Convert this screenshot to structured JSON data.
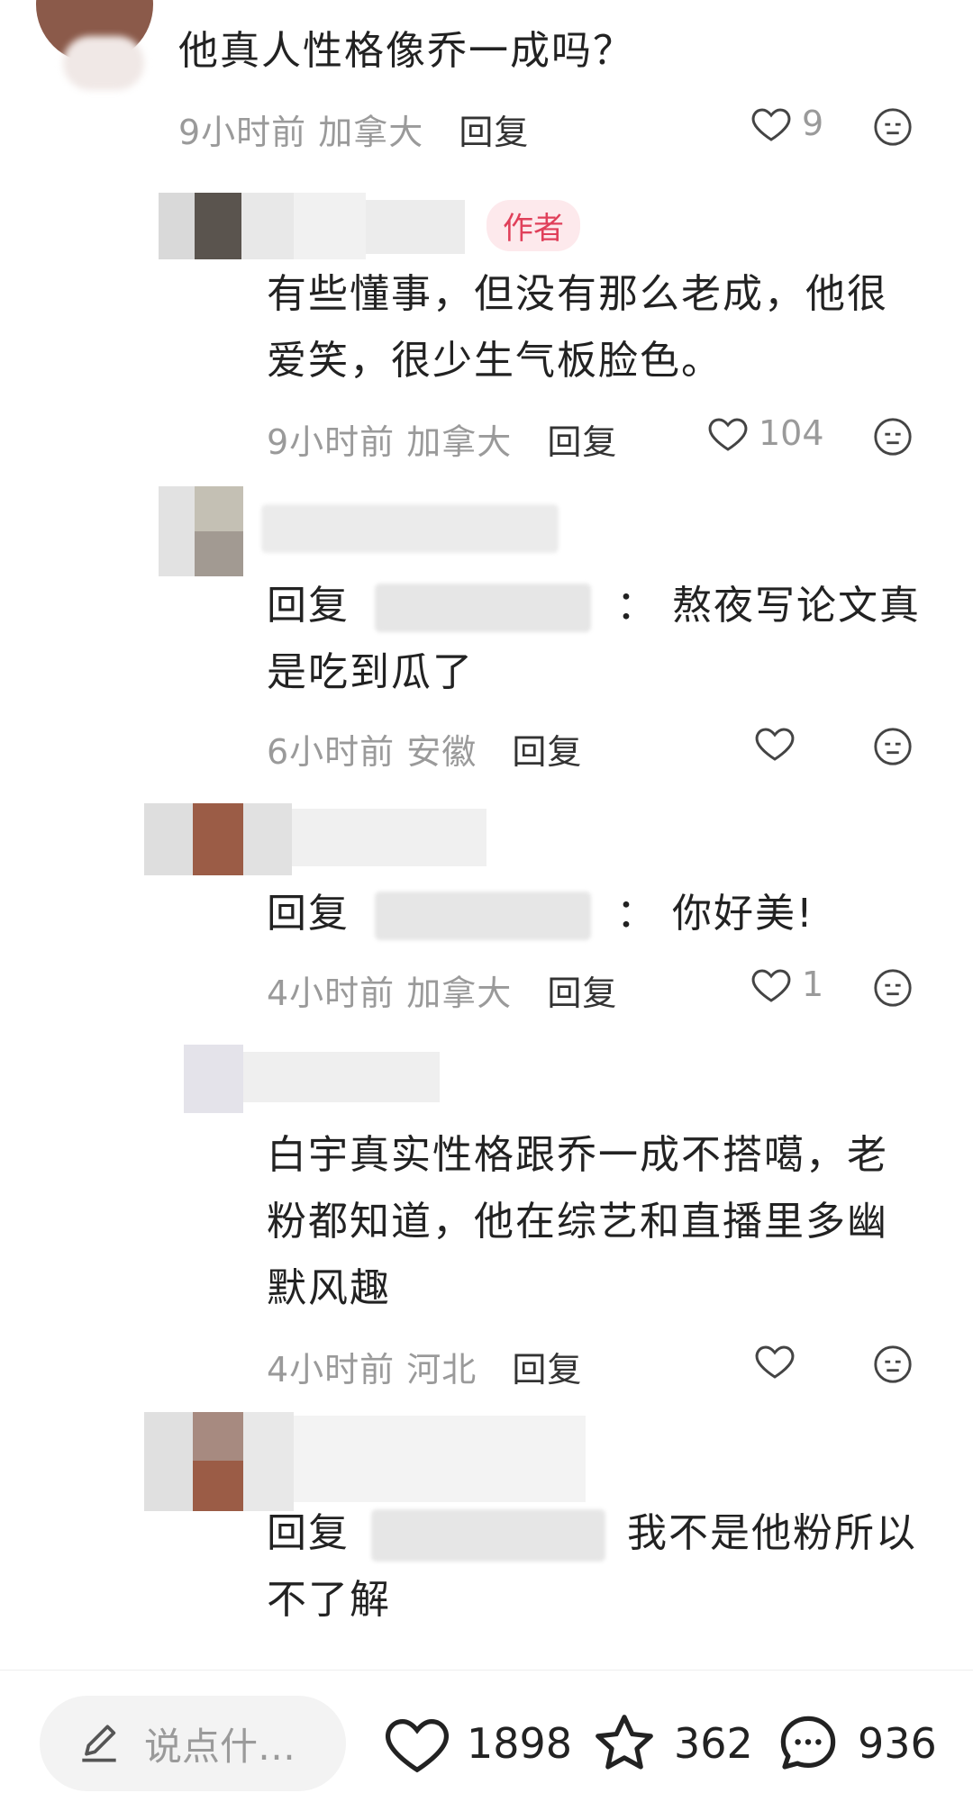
{
  "comments": [
    {
      "text": "他真人性格像乔一成吗？",
      "time": "9小时前",
      "location": "加拿大",
      "reply_label": "回复",
      "likes": "9"
    },
    {
      "badge": "作者",
      "text_line1": "有些懂事，但没有那么老成，他很",
      "text_line2": "爱笑，很少生气板脸色。",
      "time": "9小时前",
      "location": "加拿大",
      "reply_label": "回复",
      "likes": "104"
    },
    {
      "text_prefix": "回复",
      "text_sep": "：",
      "text_line1_rest": "熬夜写论文真",
      "text_line2": "是吃到瓜了",
      "time": "6小时前",
      "location": "安徽",
      "reply_label": "回复",
      "likes": ""
    },
    {
      "text_prefix": "回复",
      "text_sep": "：",
      "text_rest": "你好美!",
      "time": "4小时前",
      "location": "加拿大",
      "reply_label": "回复",
      "likes": "1"
    },
    {
      "text_line1": "白宇真实性格跟乔一成不搭噶，老",
      "text_line2": "粉都知道，他在综艺和直播里多幽",
      "text_line3": "默风趣",
      "time": "4小时前",
      "location": "河北",
      "reply_label": "回复",
      "likes": ""
    },
    {
      "text_prefix": "回复",
      "text_line1_rest": "我不是他粉所以",
      "text_line2": "不了解"
    }
  ],
  "bottom": {
    "input_placeholder": "说点什…",
    "likes": "1898",
    "stars": "362",
    "comments": "936"
  },
  "colors": {
    "accent": "#e0405a",
    "muted": "#9a9a9a",
    "text": "#222222"
  },
  "icons": [
    "heart-outline-icon",
    "emoji-face-icon",
    "pencil-icon",
    "star-outline-icon",
    "chat-bubble-icon"
  ]
}
